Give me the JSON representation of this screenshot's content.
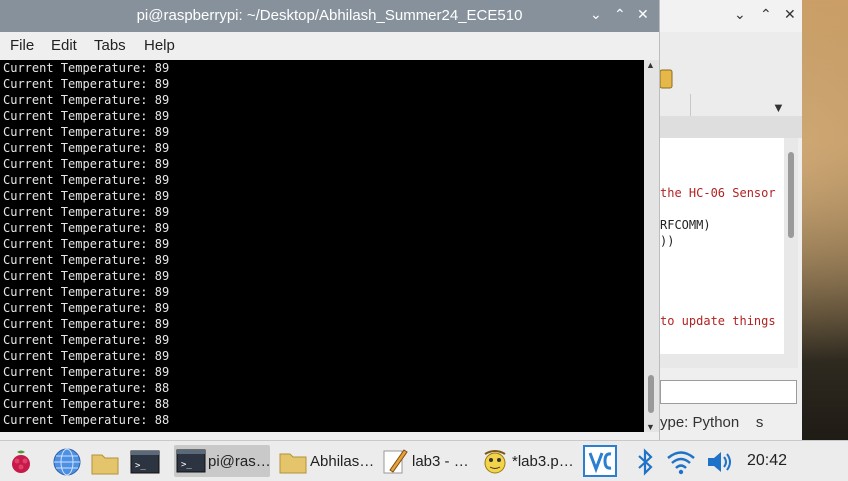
{
  "terminal": {
    "title": "pi@raspberrypi: ~/Desktop/Abhilash_Summer24_ECE510",
    "menu": [
      "File",
      "Edit",
      "Tabs",
      "Help"
    ],
    "lines": [
      "Current Temperature: 89",
      "Current Temperature: 89",
      "Current Temperature: 89",
      "Current Temperature: 89",
      "Current Temperature: 89",
      "Current Temperature: 89",
      "Current Temperature: 89",
      "Current Temperature: 89",
      "Current Temperature: 89",
      "Current Temperature: 89",
      "Current Temperature: 89",
      "Current Temperature: 89",
      "Current Temperature: 89",
      "Current Temperature: 89",
      "Current Temperature: 89",
      "Current Temperature: 89",
      "Current Temperature: 89",
      "Current Temperature: 89",
      "Current Temperature: 89",
      "Current Temperature: 89",
      "Current Temperature: 88",
      "Current Temperature: 88",
      "Current Temperature: 88"
    ]
  },
  "editor": {
    "code_lines": [
      {
        "text": "the HC-06 Sensor",
        "color": "red"
      },
      {
        "text": "RFCOMM)",
        "color": "dark"
      },
      {
        "text": "))",
        "color": "dark"
      },
      {
        "text": "to update things",
        "color": "red"
      }
    ],
    "status": "ype: Python    s"
  },
  "taskbar": {
    "tasks": [
      {
        "label": "pi@ras…",
        "icon": "terminal-icon",
        "active": true
      },
      {
        "label": "Abhilas…",
        "icon": "folder-icon",
        "active": false
      },
      {
        "label": "lab3 - …",
        "icon": "text-editor-icon",
        "active": false
      },
      {
        "label": "*lab3.p…",
        "icon": "thonny-icon",
        "active": false
      }
    ],
    "clock": "20:42"
  },
  "colors": {
    "titlebar_active": "#87919c",
    "terminal_bg": "#000000",
    "terminal_fg": "#e6e6e6",
    "code_red": "#b22222"
  }
}
